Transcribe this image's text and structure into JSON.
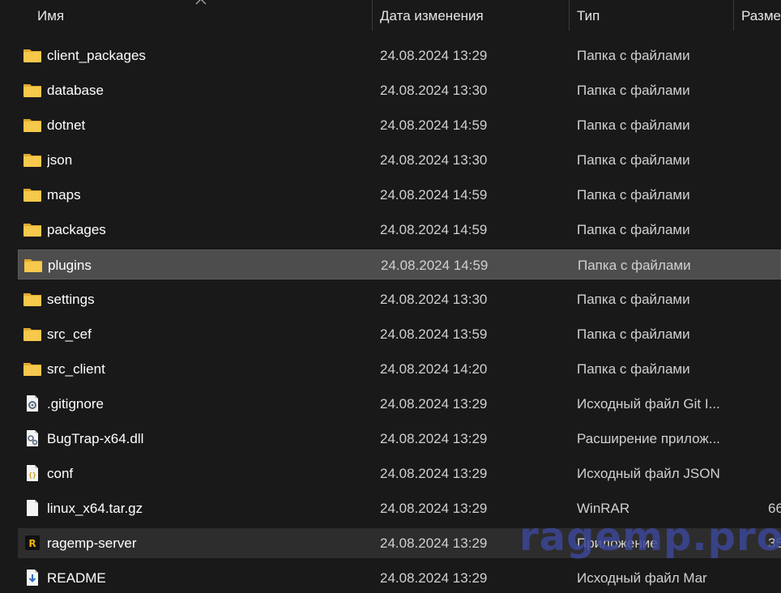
{
  "columns": {
    "name": "Имя",
    "date": "Дата изменения",
    "type": "Тип",
    "size": "Разме"
  },
  "files": [
    {
      "name": "client_packages",
      "date": "24.08.2024 13:29",
      "type": "Папка с файлами",
      "size": "",
      "icon": "folder-icon"
    },
    {
      "name": "database",
      "date": "24.08.2024 13:30",
      "type": "Папка с файлами",
      "size": "",
      "icon": "folder-icon"
    },
    {
      "name": "dotnet",
      "date": "24.08.2024 14:59",
      "type": "Папка с файлами",
      "size": "",
      "icon": "folder-icon"
    },
    {
      "name": "json",
      "date": "24.08.2024 13:30",
      "type": "Папка с файлами",
      "size": "",
      "icon": "folder-icon"
    },
    {
      "name": "maps",
      "date": "24.08.2024 14:59",
      "type": "Папка с файлами",
      "size": "",
      "icon": "folder-icon"
    },
    {
      "name": "packages",
      "date": "24.08.2024 14:59",
      "type": "Папка с файлами",
      "size": "",
      "icon": "folder-icon"
    },
    {
      "name": "plugins",
      "date": "24.08.2024 14:59",
      "type": "Папка с файлами",
      "size": "",
      "icon": "folder-icon"
    },
    {
      "name": "settings",
      "date": "24.08.2024 13:30",
      "type": "Папка с файлами",
      "size": "",
      "icon": "folder-icon"
    },
    {
      "name": "src_cef",
      "date": "24.08.2024 13:59",
      "type": "Папка с файлами",
      "size": "",
      "icon": "folder-icon"
    },
    {
      "name": "src_client",
      "date": "24.08.2024 14:20",
      "type": "Папка с файлами",
      "size": "",
      "icon": "folder-icon"
    },
    {
      "name": ".gitignore",
      "date": "24.08.2024 13:29",
      "type": "Исходный файл Git I...",
      "size": "",
      "icon": "config-file-icon"
    },
    {
      "name": "BugTrap-x64.dll",
      "date": "24.08.2024 13:29",
      "type": "Расширение прилож...",
      "size": "",
      "icon": "dll-file-icon"
    },
    {
      "name": "conf",
      "date": "24.08.2024 13:29",
      "type": "Исходный файл JSON",
      "size": "",
      "icon": "json-file-icon"
    },
    {
      "name": "linux_x64.tar.gz",
      "date": "24.08.2024 13:29",
      "type": "WinRAR",
      "size": "66",
      "icon": "archive-file-icon"
    },
    {
      "name": "ragemp-server",
      "date": "24.08.2024 13:29",
      "type": "Приложение",
      "size": "35",
      "icon": "ragemp-app-icon"
    },
    {
      "name": "README",
      "date": "24.08.2024 13:29",
      "type": "Исходный файл Mar",
      "size": "",
      "icon": "markdown-file-icon"
    }
  ],
  "watermark": "ragemp.pro",
  "colors": {
    "background": "#191919",
    "folder": "#f3c24a",
    "selected_row": "#4d4d4d",
    "hover_row": "#2d2d2d",
    "watermark": "#3c4696"
  }
}
